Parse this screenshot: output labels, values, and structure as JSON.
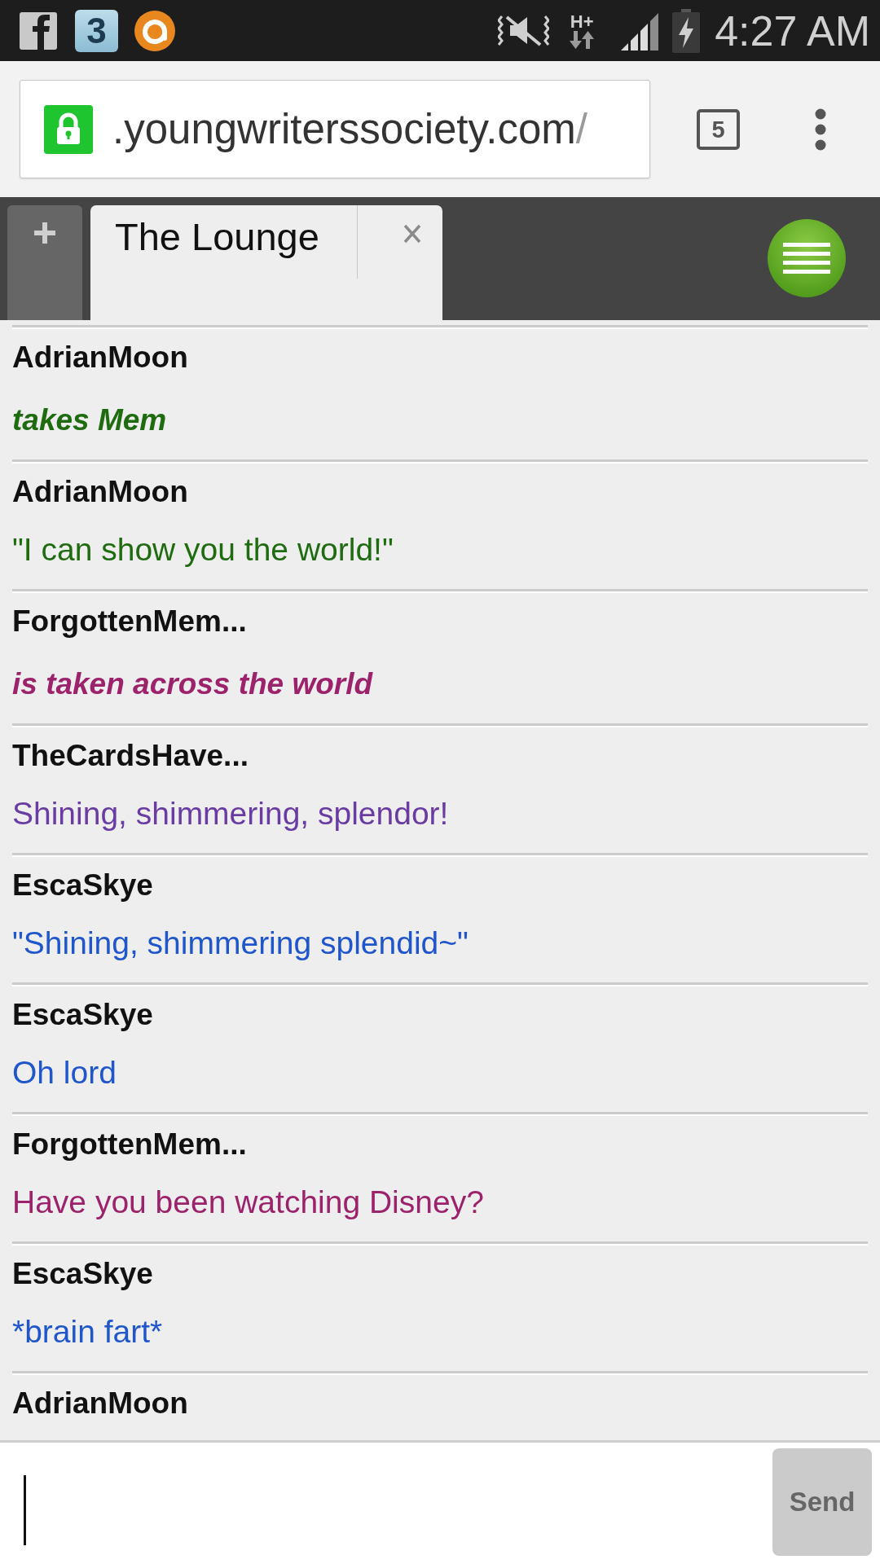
{
  "status_bar": {
    "app_badge": "3",
    "network": "H+",
    "time": "4:27 AM"
  },
  "browser": {
    "secure": true,
    "url": {
      "host": ".youngwriterssociety.com",
      "path": "/"
    },
    "tab_count": "5"
  },
  "chat_tabs": [
    {
      "label": "The Lounge",
      "selected": true
    }
  ],
  "messages": [
    {
      "user": "AdrianMoon",
      "text": "takes Mem",
      "kind": "action",
      "color": "#1f6b10"
    },
    {
      "user": "AdrianMoon",
      "text": "\"I can show you the world!\"",
      "kind": "say",
      "color": "#1f6b10"
    },
    {
      "user": "ForgottenMem...",
      "text": "is taken across the world",
      "kind": "action",
      "color": "#9c226c"
    },
    {
      "user": "TheCardsHave...",
      "text": "Shining, shimmering, splendor!",
      "kind": "say",
      "color": "#6a3ca3"
    },
    {
      "user": "EscaSkye",
      "text": "\"Shining, shimmering splendid~\"",
      "kind": "say",
      "color": "#1f56cc"
    },
    {
      "user": "EscaSkye",
      "text": "Oh lord",
      "kind": "say",
      "color": "#1f56cc"
    },
    {
      "user": "ForgottenMem...",
      "text": "Have you been watching Disney?",
      "kind": "say",
      "color": "#9c226c"
    },
    {
      "user": "EscaSkye",
      "text": "*brain fart*",
      "kind": "say",
      "color": "#1f56cc"
    },
    {
      "user": "AdrianMoon"
    }
  ],
  "composer": {
    "focused": true,
    "send_button": {
      "label": "Send",
      "disabled": true
    }
  }
}
